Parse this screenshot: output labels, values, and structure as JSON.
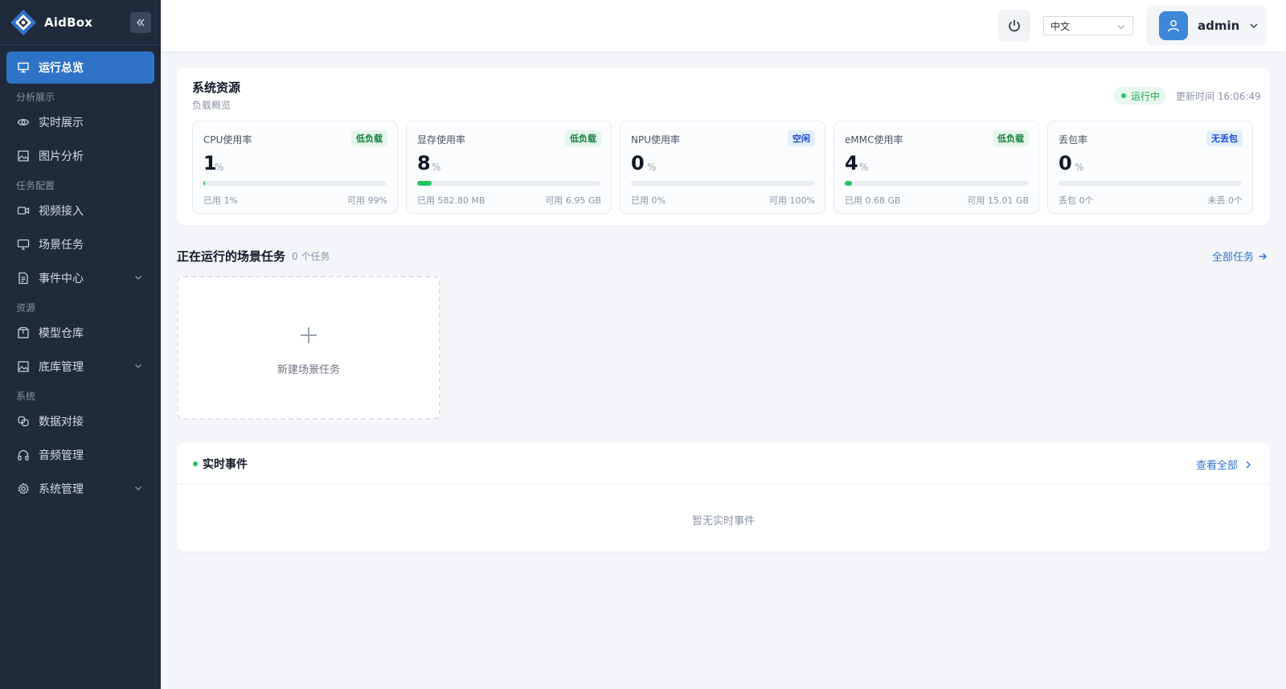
{
  "app": {
    "name": "AidBox"
  },
  "sidebar": {
    "items": [
      {
        "label": "运行总览"
      },
      {
        "label": "实时展示"
      },
      {
        "label": "图片分析"
      },
      {
        "label": "视频接入"
      },
      {
        "label": "场景任务"
      },
      {
        "label": "事件中心"
      },
      {
        "label": "模型仓库"
      },
      {
        "label": "底库管理"
      },
      {
        "label": "数据对接"
      },
      {
        "label": "音频管理"
      },
      {
        "label": "系统管理"
      }
    ],
    "groups": {
      "analysis": "分析展示",
      "task_config": "任务配置",
      "resources": "资源",
      "system": "系统"
    }
  },
  "header": {
    "language": "中文",
    "user": "admin"
  },
  "resources": {
    "title": "系统资源",
    "subtitle": "负载概览",
    "status": "运行中",
    "updated": "更新时间 16:06:49",
    "unit": "%",
    "metrics": [
      {
        "label": "CPU使用率",
        "badge": "低负载",
        "value": "1",
        "percent": 1,
        "used": "已用 1%",
        "free": "可用 99%"
      },
      {
        "label": "显存使用率",
        "badge": "低负载",
        "value": "8",
        "percent": 8,
        "used": "已用 582.80 MB",
        "free": "可用 6.95 GB"
      },
      {
        "label": "NPU使用率",
        "badge": "空闲",
        "value": "0",
        "percent": 0,
        "used": "已用 0%",
        "free": "可用 100%"
      },
      {
        "label": "eMMC使用率",
        "badge": "低负载",
        "value": "4",
        "percent": 4,
        "used": "已用 0.68 GB",
        "free": "可用 15.01 GB"
      },
      {
        "label": "丢包率",
        "badge": "无丢包",
        "value": "0",
        "percent": 0,
        "used": "丢包 0个",
        "free": "未丢 0个"
      }
    ]
  },
  "tasks": {
    "title": "正在运行的场景任务",
    "count": "0 个任务",
    "all_link": "全部任务",
    "new_label": "新建场景任务"
  },
  "events": {
    "title": "实时事件",
    "view_all": "查看全部",
    "empty": "暂无实时事件"
  },
  "colors": {
    "sidebar_bg": "#1f2a3c",
    "accent": "#2f73c9",
    "success": "#22c55e"
  }
}
